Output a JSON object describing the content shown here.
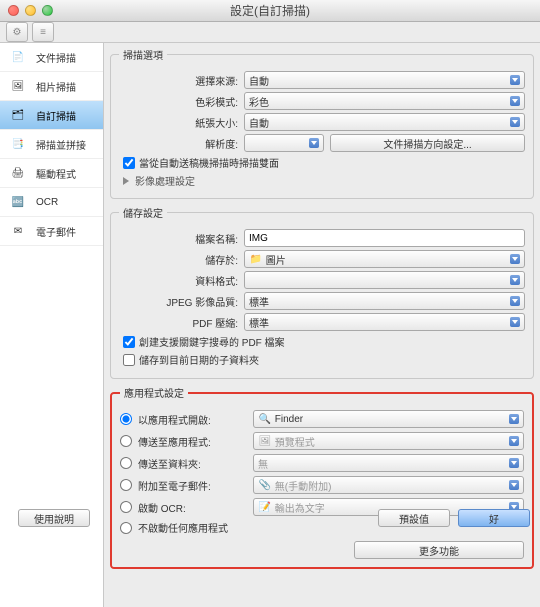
{
  "window": {
    "title": "設定(自訂掃描)"
  },
  "sidebar": {
    "items": [
      {
        "label": "文件掃描"
      },
      {
        "label": "相片掃描"
      },
      {
        "label": "自訂掃描"
      },
      {
        "label": "掃描並拼接"
      },
      {
        "label": "驅動程式"
      },
      {
        "label": "OCR"
      },
      {
        "label": "電子郵件"
      }
    ]
  },
  "scanOptions": {
    "legend": "掃描選項",
    "source_label": "選擇來源:",
    "source_value": "自動",
    "colormode_label": "色彩模式:",
    "colormode_value": "彩色",
    "papersize_label": "紙張大小:",
    "papersize_value": "自動",
    "resolution_label": "解析度:",
    "resolution_value": "",
    "orientation_btn": "文件掃描方向設定...",
    "adf_duplex_checkbox": "當從自動送稿機掃描時掃描雙面",
    "image_processing": "影像處理設定"
  },
  "saveSettings": {
    "legend": "儲存設定",
    "filename_label": "檔案名稱:",
    "filename_value": "IMG",
    "savein_label": "儲存於:",
    "savein_value": "圖片",
    "format_label": "資料格式:",
    "format_value": "",
    "jpeg_label": "JPEG 影像品質:",
    "jpeg_value": "標準",
    "pdf_label": "PDF 壓縮:",
    "pdf_value": "標準",
    "keyword_pdf_checkbox": "創建支援關鍵字搜尋的 PDF 檔案",
    "date_subfolder_checkbox": "儲存到目前日期的子資料夾"
  },
  "appSettings": {
    "legend": "應用程式設定",
    "radios": {
      "open_with": "以應用程式開啟:",
      "send_to_app": "傳送至應用程式:",
      "send_to_folder": "傳送至資料夾:",
      "attach_email": "附加至電子郵件:",
      "start_ocr": "啟動 OCR:",
      "do_nothing": "不啟動任何應用程式"
    },
    "values": {
      "open_with": "Finder",
      "send_to_app": "預覽程式",
      "send_to_folder": "無",
      "attach_email": "無(手動附加)",
      "start_ocr": "輸出為文字"
    },
    "more_functions": "更多功能"
  },
  "footer": {
    "instructions": "使用說明",
    "defaults": "預設值",
    "ok": "好"
  }
}
